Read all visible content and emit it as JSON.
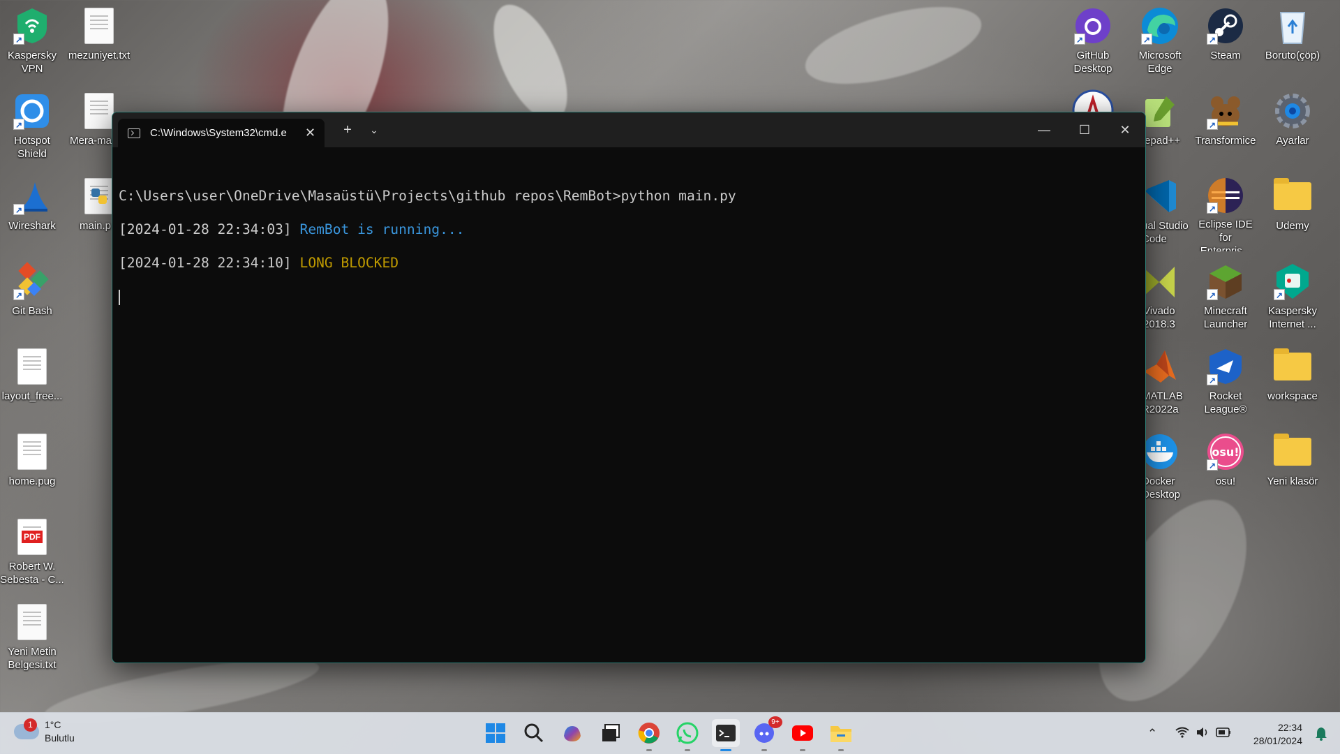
{
  "desktop": {
    "left_icons": [
      {
        "label": "Kaspersky VPN",
        "icon": "kaspersky-vpn-icon"
      },
      {
        "label": "mezuniyet.txt",
        "icon": "text-file-icon"
      },
      {
        "label": "Hotspot Shield",
        "icon": "hotspot-shield-icon"
      },
      {
        "label": "Mera-ma",
        "icon": "text-file-icon"
      },
      {
        "label": "Wireshark",
        "icon": "wireshark-icon"
      },
      {
        "label": "main.p",
        "icon": "python-file-icon"
      },
      {
        "label": "Git Bash",
        "icon": "git-bash-icon"
      },
      {
        "label": "layout_free...",
        "icon": "file-icon"
      },
      {
        "label": "home.pug",
        "icon": "file-icon"
      },
      {
        "label": "Robert W. Sebesta - C...",
        "icon": "pdf-icon"
      },
      {
        "label": "Yeni Metin Belgesi.txt",
        "icon": "text-file-icon"
      }
    ],
    "right_icons": [
      {
        "label": "GitHub Desktop",
        "icon": "github-desktop-icon"
      },
      {
        "label": "Microsoft Edge",
        "icon": "edge-icon"
      },
      {
        "label": "Steam",
        "icon": "steam-icon"
      },
      {
        "label": "Boruto(çöp)",
        "icon": "recycle-bin-icon"
      },
      {
        "label": "tepad++",
        "icon": "notepadpp-icon"
      },
      {
        "label": "Transformice",
        "icon": "transformice-icon"
      },
      {
        "label": "Ayarlar",
        "icon": "settings-icon"
      },
      {
        "label": "ual Studio Code",
        "icon": "vscode-icon"
      },
      {
        "label": "Eclipse IDE for Enterpris...",
        "icon": "eclipse-icon"
      },
      {
        "label": "Udemy",
        "icon": "folder-icon"
      },
      {
        "label": "Vivado 2018.3",
        "icon": "vivado-icon"
      },
      {
        "label": "Minecraft Launcher",
        "icon": "minecraft-icon"
      },
      {
        "label": "Kaspersky Internet ...",
        "icon": "kaspersky-internet-icon"
      },
      {
        "label": "MATLAB R2022a",
        "icon": "matlab-icon"
      },
      {
        "label": "Rocket League®",
        "icon": "rocket-league-icon"
      },
      {
        "label": "workspace",
        "icon": "folder-icon"
      },
      {
        "label": "Docker Desktop",
        "icon": "docker-icon"
      },
      {
        "label": "osu!",
        "icon": "osu-icon"
      },
      {
        "label": "Yeni klasör",
        "icon": "folder-icon"
      }
    ]
  },
  "terminal": {
    "tab_title": "C:\\Windows\\System32\\cmd.e",
    "prompt_line": "C:\\Users\\user\\OneDrive\\Masaüstü\\Projects\\github repos\\RemBot>python main.py",
    "log1_time": "[2024-01-28 22:34:03]",
    "log1_msg": "RemBot is running...",
    "log1_color": "#3a96dd",
    "log2_time": "[2024-01-28 22:34:10]",
    "log2_msg": "LONG BLOCKED",
    "log2_color": "#c19c00"
  },
  "taskbar": {
    "weather_temp": "1°C",
    "weather_desc": "Bulutlu",
    "weather_badge": "1",
    "discord_badge": "9+",
    "clock_time": "22:34",
    "clock_date": "28/01/2024",
    "apps": [
      "start-icon",
      "search-icon",
      "copilot-icon",
      "task-view-icon",
      "chrome-icon",
      "whatsapp-icon",
      "terminal-icon",
      "discord-icon",
      "youtube-icon",
      "file-explorer-icon"
    ]
  }
}
